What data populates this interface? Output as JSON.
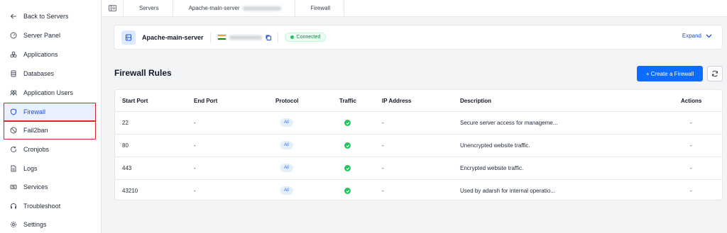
{
  "sidebar": {
    "items": [
      {
        "label": "Back to Servers",
        "icon": "arrow-left-icon"
      },
      {
        "label": "Server Panel",
        "icon": "gauge-icon"
      },
      {
        "label": "Applications",
        "icon": "apps-icon"
      },
      {
        "label": "Databases",
        "icon": "database-icon"
      },
      {
        "label": "Application Users",
        "icon": "users-icon"
      },
      {
        "label": "Firewall",
        "icon": "shield-icon"
      },
      {
        "label": "Fail2ban",
        "icon": "ban-icon"
      },
      {
        "label": "Cronjobs",
        "icon": "cron-icon"
      },
      {
        "label": "Logs",
        "icon": "file-icon"
      },
      {
        "label": "Services",
        "icon": "services-icon"
      },
      {
        "label": "Troubleshoot",
        "icon": "headset-icon"
      },
      {
        "label": "Settings",
        "icon": "gear-icon"
      }
    ]
  },
  "breadcrumb": {
    "servers": "Servers",
    "server": "Apache-main-server",
    "current": "Firewall"
  },
  "server_card": {
    "name": "Apache-main-server",
    "status": "Connected",
    "expand_label": "Expand"
  },
  "page": {
    "title": "Firewall Rules",
    "create_label": "+ Create a Firewall"
  },
  "table": {
    "headers": {
      "start_port": "Start Port",
      "end_port": "End Port",
      "protocol": "Protocol",
      "traffic": "Traffic",
      "ip_address": "IP Address",
      "description": "Description",
      "actions": "Actions"
    },
    "rows": [
      {
        "start_port": "22",
        "end_port": "-",
        "protocol": "All",
        "ip_address": "-",
        "description": "Secure server access for manageme...",
        "actions": "-"
      },
      {
        "start_port": "80",
        "end_port": "-",
        "protocol": "All",
        "ip_address": "-",
        "description": "Unencrypted website traffic.",
        "actions": "-"
      },
      {
        "start_port": "443",
        "end_port": "-",
        "protocol": "All",
        "ip_address": "-",
        "description": "Encrypted website traffic.",
        "actions": "-"
      },
      {
        "start_port": "43210",
        "end_port": "-",
        "protocol": "All",
        "ip_address": "-",
        "description": "Used by adarsh for internal operatio...",
        "actions": "-"
      }
    ]
  },
  "colors": {
    "accent": "#0b6cff",
    "active_bg": "#e8f0fe",
    "highlight_box": "#dc2626",
    "success": "#22c55e"
  }
}
